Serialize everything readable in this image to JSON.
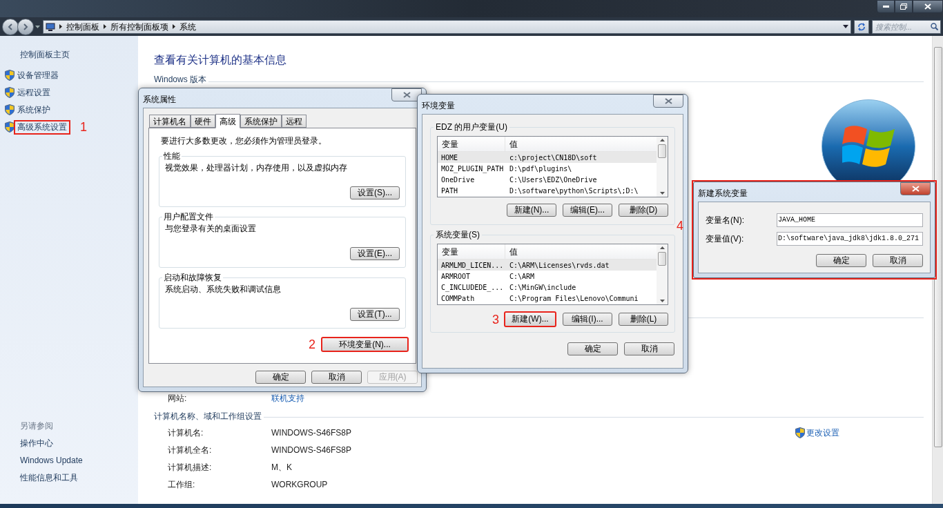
{
  "window": {
    "breadcrumb": [
      "控制面板",
      "所有控制面板项",
      "系统"
    ],
    "search": {
      "placeholder": "搜索控制..."
    }
  },
  "sidebar": {
    "home": "控制面板主页",
    "items": [
      {
        "label": "设备管理器",
        "highlighted": false
      },
      {
        "label": "远程设置",
        "highlighted": false
      },
      {
        "label": "系统保护",
        "highlighted": false
      },
      {
        "label": "高级系统设置",
        "highlighted": true,
        "annotation": "1"
      }
    ],
    "see_also_title": "另请参阅",
    "see_also": [
      "操作中心",
      "Windows Update",
      "性能信息和工具"
    ]
  },
  "main": {
    "title": "查看有关计算机的基本信息",
    "section": "Windows 版本",
    "website": {
      "label": "网站:",
      "value": "联机支持"
    },
    "computer_section": {
      "title": "计算机名称、域和工作组设置",
      "change_link": "更改设置",
      "rows": [
        {
          "label": "计算机名:",
          "value": "WINDOWS-S46FS8P"
        },
        {
          "label": "计算机全名:",
          "value": "WINDOWS-S46FS8P"
        },
        {
          "label": "计算机描述:",
          "value": "M、K"
        },
        {
          "label": "工作组:",
          "value": "WORKGROUP"
        }
      ]
    }
  },
  "system_properties": {
    "title": "系统属性",
    "tabs": [
      {
        "label": "计算机名",
        "selected": false
      },
      {
        "label": "硬件",
        "selected": false
      },
      {
        "label": "高级",
        "selected": true
      },
      {
        "label": "系统保护",
        "selected": false
      },
      {
        "label": "远程",
        "selected": false
      }
    ],
    "notice": "要进行大多数更改，您必须作为管理员登录。",
    "groups": [
      {
        "title": "性能",
        "description": "视觉效果，处理器计划，内存使用，以及虚拟内存",
        "button": "设置(S)..."
      },
      {
        "title": "用户配置文件",
        "description": "与您登录有关的桌面设置",
        "button": "设置(E)..."
      },
      {
        "title": "启动和故障恢复",
        "description": "系统启动、系统失败和调试信息",
        "button": "设置(T)..."
      }
    ],
    "env_button": {
      "label": "环境变量(N)...",
      "highlighted": true,
      "annotation": "2"
    },
    "buttons": [
      {
        "label": "确定",
        "disabled": false
      },
      {
        "label": "取消",
        "disabled": false
      },
      {
        "label": "应用(A)",
        "disabled": true
      }
    ]
  },
  "env_vars": {
    "title": "环境变量",
    "lists": [
      {
        "title": "EDZ 的用户变量(U)",
        "columns": [
          "变量",
          "值"
        ],
        "rows": [
          {
            "name": "HOME",
            "value": "c:\\project\\CN18D\\soft",
            "selected": true
          },
          {
            "name": "MOZ_PLUGIN_PATH",
            "value": "D:\\pdf\\plugins\\",
            "selected": false
          },
          {
            "name": "OneDrive",
            "value": "C:\\Users\\EDZ\\OneDrive",
            "selected": false
          },
          {
            "name": "PATH",
            "value": "D:\\software\\python\\Scripts\\;D:\\",
            "selected": false
          }
        ],
        "buttons": [
          {
            "label": "新建(N)...",
            "highlighted": false
          },
          {
            "label": "编辑(E)...",
            "highlighted": false
          },
          {
            "label": "删除(D)",
            "highlighted": false
          }
        ]
      },
      {
        "title": "系统变量(S)",
        "columns": [
          "变量",
          "值"
        ],
        "rows": [
          {
            "name": "ARMLMD_LICEN...",
            "value": "C:\\ARM\\Licenses\\rvds.dat",
            "selected": true
          },
          {
            "name": "ARMROOT",
            "value": "C:\\ARM",
            "selected": false
          },
          {
            "name": "C_INCLUDEDE_...",
            "value": "C:\\MinGW\\include",
            "selected": false
          },
          {
            "name": "COMMPath",
            "value": "C:\\Program Files\\Lenovo\\Communi",
            "selected": false
          }
        ],
        "buttons": [
          {
            "label": "新建(W)...",
            "highlighted": true,
            "annotation": "3"
          },
          {
            "label": "编辑(I)...",
            "highlighted": false
          },
          {
            "label": "删除(L)",
            "highlighted": false
          }
        ]
      }
    ],
    "buttons": [
      "确定",
      "取消"
    ]
  },
  "new_variable": {
    "title": "新建系统变量",
    "highlighted": true,
    "annotation": "4",
    "fields": [
      {
        "label": "变量名(N):",
        "value": "JAVA_HOME"
      },
      {
        "label": "变量值(V):",
        "value": "D:\\software\\java_jdk8\\jdk1.8.0_271"
      }
    ],
    "buttons": [
      "确定",
      "取消"
    ]
  }
}
